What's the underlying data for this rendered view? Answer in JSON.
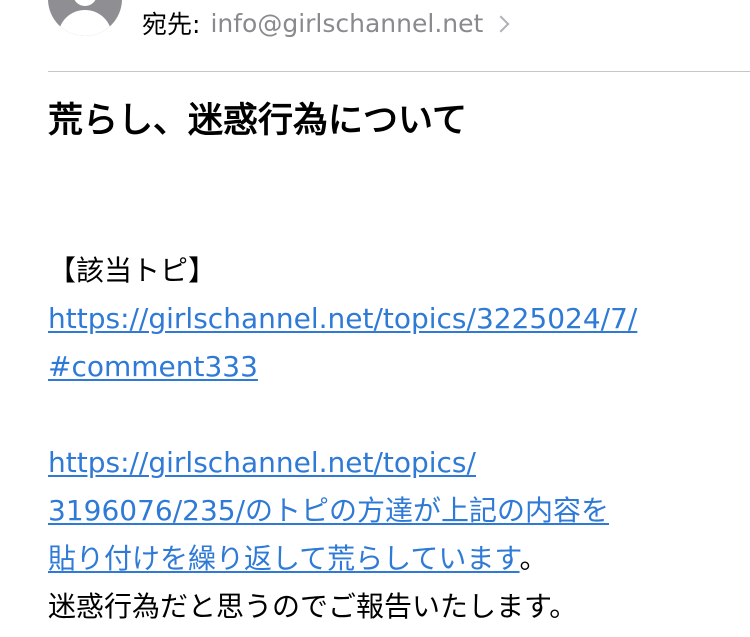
{
  "header": {
    "to_label": "宛先:",
    "to_address": "info@girlschannel.net",
    "chevron_icon": "chevron-right-icon",
    "avatar_icon": "person-icon"
  },
  "subject": "荒らし、迷惑行為について",
  "body": {
    "topic_heading": "【該当トピ】",
    "link1_part1": "https://girlschannel.net/topics/3225024/7/",
    "link1_part2": "#comment333",
    "link2_part1": "https://girlschannel.net/topics/",
    "link2_part2": "3196076/235/のトピの方達が上記の内容を",
    "link2_part3": "貼り付けを繰り返して荒らしています",
    "sentence_end": "。",
    "closing": "迷惑行為だと思うのでご報告いたします。"
  },
  "colors": {
    "link": "#2f7ad6",
    "secondary_text": "#8a8a8e",
    "divider": "#c6c6c8",
    "avatar": "#8e8e93"
  }
}
